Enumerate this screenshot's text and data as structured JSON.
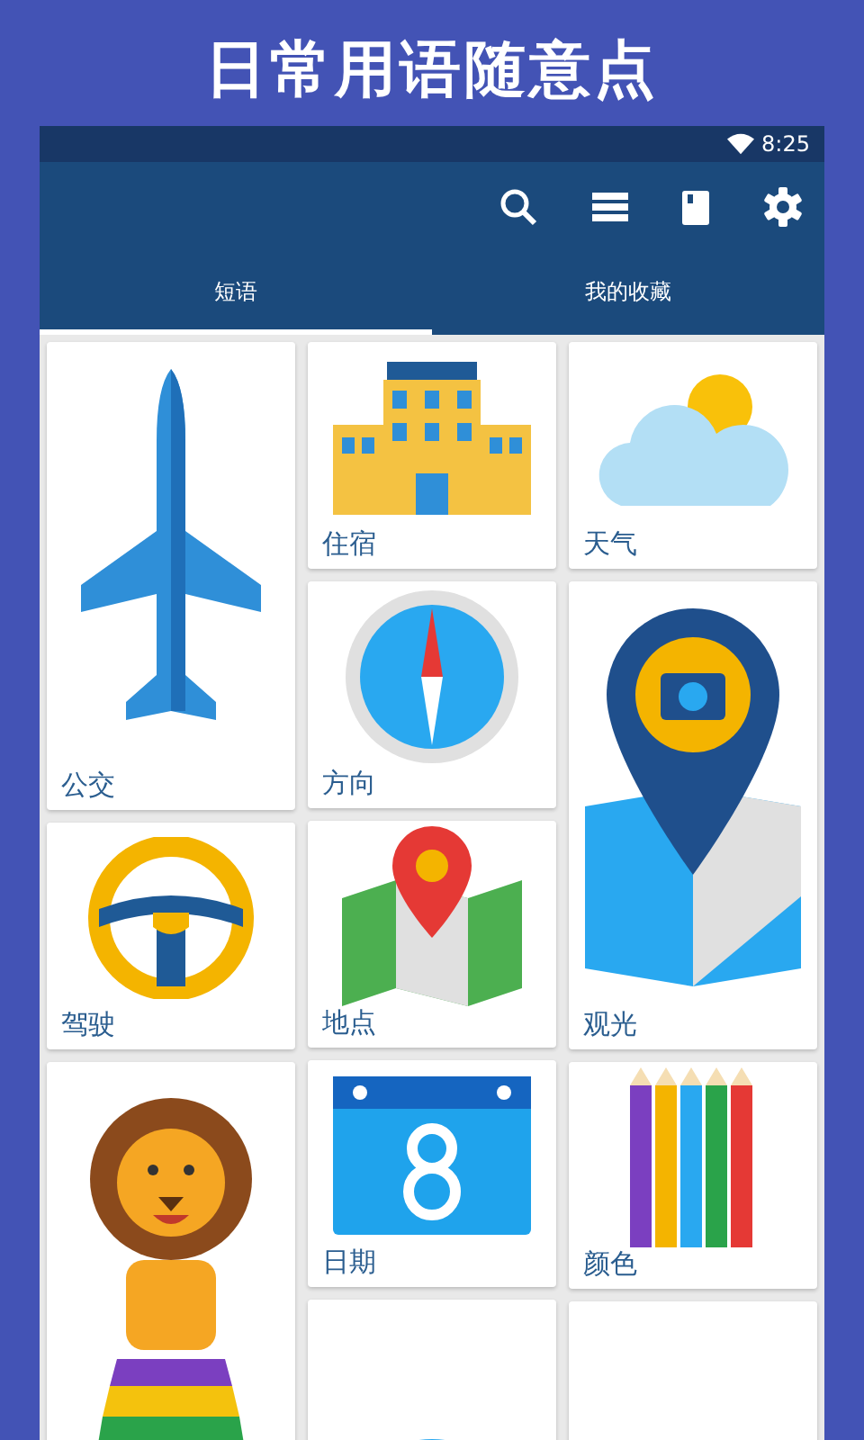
{
  "headline": "日常用语随意点",
  "status_bar": {
    "time": "8:25"
  },
  "tabs": [
    {
      "label": "短语",
      "selected": true
    },
    {
      "label": "我的收藏",
      "selected": false
    }
  ],
  "columns": [
    [
      {
        "label": "公交",
        "kind": "tall"
      },
      {
        "label": "驾驶",
        "kind": "short"
      },
      {
        "kind": "cut"
      }
    ],
    [
      {
        "label": "住宿",
        "kind": "short"
      },
      {
        "label": "方向",
        "kind": "short"
      },
      {
        "label": "地点",
        "kind": "short"
      },
      {
        "label": "日期",
        "kind": "short"
      },
      {
        "kind": "cut"
      }
    ],
    [
      {
        "label": "天气",
        "kind": "short"
      },
      {
        "label": "观光",
        "kind": "tall"
      },
      {
        "label": "颜色",
        "kind": "short"
      },
      {
        "kind": "cut"
      }
    ]
  ]
}
